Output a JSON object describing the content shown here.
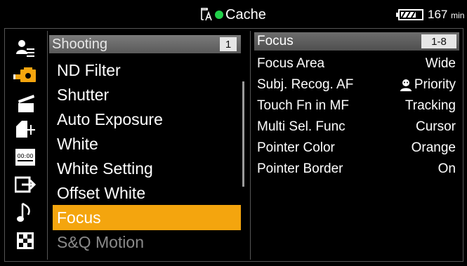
{
  "colors": {
    "accent_orange": "#f4a50e",
    "accent_green": "#21d04a",
    "header_gray": "#6a6a6a",
    "dimmed_text": "#8a8a8a"
  },
  "status_bar": {
    "media_icon": "media-card-icon",
    "recording_indicator": "green-dot",
    "title": "Cache",
    "battery_level_fraction": 0.75,
    "battery_value": "167",
    "battery_unit": "min"
  },
  "icon_rail": [
    {
      "name": "user-menu-icon"
    },
    {
      "name": "camera-shooting-icon",
      "active": true
    },
    {
      "name": "clapperboard-icon"
    },
    {
      "name": "media-settings-icon"
    },
    {
      "name": "timecode-icon"
    },
    {
      "name": "output-icon"
    },
    {
      "name": "audio-note-icon"
    },
    {
      "name": "grid-settings-icon"
    }
  ],
  "menu": {
    "header_title": "Shooting",
    "page": "1",
    "items": [
      {
        "label": "ND Filter"
      },
      {
        "label": "Shutter"
      },
      {
        "label": "Auto Exposure"
      },
      {
        "label": "White"
      },
      {
        "label": "White Setting"
      },
      {
        "label": "Offset White"
      },
      {
        "label": "Focus",
        "selected": true
      },
      {
        "label": "S&Q Motion",
        "dimmed": true
      }
    ]
  },
  "panel": {
    "header_title": "Focus",
    "page_range": "1-8",
    "settings": [
      {
        "label": "Focus Area",
        "value": "Wide"
      },
      {
        "label": "Subj. Recog. AF",
        "value": "Priority",
        "value_icon": "face-recognition-icon"
      },
      {
        "label": "Touch Fn in MF",
        "value": "Tracking"
      },
      {
        "label": "Multi Sel. Func",
        "value": "Cursor"
      },
      {
        "label": "Pointer Color",
        "value": "Orange"
      },
      {
        "label": "Pointer Border",
        "value": "On"
      }
    ]
  }
}
